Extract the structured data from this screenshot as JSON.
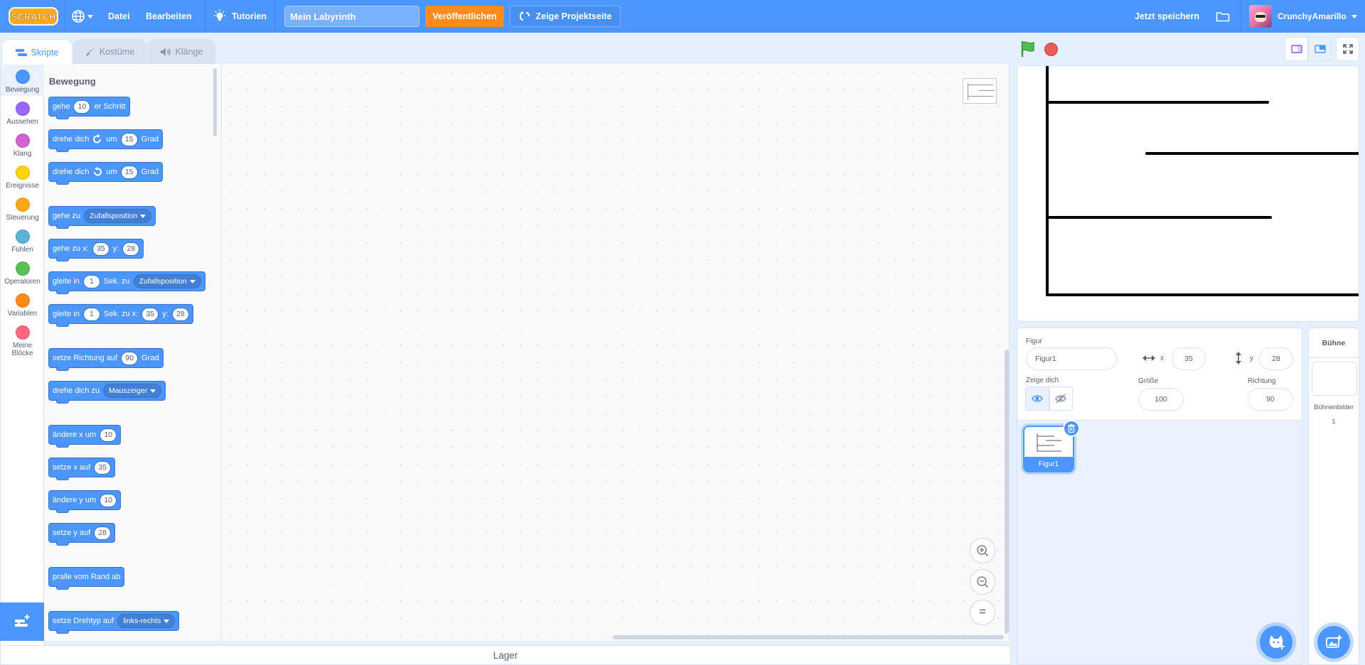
{
  "menubar": {
    "logo_text": "SCRATCH",
    "file": "Datei",
    "edit": "Bearbeiten",
    "tutorials": "Tutorien",
    "project_title": "Mein Labyrinth",
    "publish": "Veröffentlichen",
    "project_page": "Zeige Projektseite",
    "save_now": "Jetzt speichern",
    "username": "CrunchyAmarillo"
  },
  "tabs": {
    "code": "Skripte",
    "costumes": "Kostüme",
    "sounds": "Klänge"
  },
  "categories": [
    {
      "label": "Bewegung",
      "color": "#4c97ff"
    },
    {
      "label": "Aussehen",
      "color": "#9966ff"
    },
    {
      "label": "Klang",
      "color": "#cf63cf"
    },
    {
      "label": "Ereignisse",
      "color": "#ffd500"
    },
    {
      "label": "Steuerung",
      "color": "#ffab19"
    },
    {
      "label": "Fühlen",
      "color": "#5cb1d6"
    },
    {
      "label": "Operatoren",
      "color": "#59c059"
    },
    {
      "label": "Variablen",
      "color": "#ff8c1a"
    },
    {
      "label": "Meine Blöcke",
      "color": "#ff6680"
    }
  ],
  "palette": {
    "section": "Bewegung",
    "b1": {
      "a": "gehe",
      "v": "10",
      "b": "er Schritt"
    },
    "b2": {
      "a": "drehe dich",
      "b": "um",
      "v": "15",
      "c": "Grad"
    },
    "b3": {
      "a": "drehe dich",
      "b": "um",
      "v": "15",
      "c": "Grad"
    },
    "b4": {
      "a": "gehe zu",
      "dd": "Zufallsposition"
    },
    "b5": {
      "a": "gehe zu x:",
      "x": "35",
      "b": "y:",
      "y": "28"
    },
    "b6": {
      "a": "gleite in",
      "v": "1",
      "b": "Sek. zu",
      "dd": "Zufallsposition"
    },
    "b7": {
      "a": "gleite in",
      "v": "1",
      "b": "Sek. zu x:",
      "x": "35",
      "c": "y:",
      "y": "28"
    },
    "b8": {
      "a": "setze Richtung auf",
      "v": "90",
      "b": "Grad"
    },
    "b9": {
      "a": "drehe dich zu",
      "dd": "Mauszeiger"
    },
    "b10": {
      "a": "ändere x um",
      "v": "10"
    },
    "b11": {
      "a": "setze x auf",
      "v": "35"
    },
    "b12": {
      "a": "ändere y um",
      "v": "10"
    },
    "b13": {
      "a": "setze y auf",
      "v": "28"
    },
    "b14": {
      "a": "pralle vom Rand ab"
    },
    "b15": {
      "a": "setze Drehtyp auf",
      "dd": "links-rechts"
    }
  },
  "workspace": {
    "zoom_in": "+",
    "zoom_out": "−",
    "zoom_reset": "="
  },
  "backpack": "Lager",
  "sprite_info": {
    "sprite_label": "Figur",
    "sprite_name": "Figur1",
    "x_label": "x",
    "x": "35",
    "y_label": "y",
    "y": "28",
    "show_label": "Zeige dich",
    "size_label": "Größe",
    "size": "100",
    "direction_label": "Richtung",
    "direction": "90"
  },
  "sprites": [
    {
      "name": "Figur1"
    }
  ],
  "stage_pane": {
    "title": "Bühne",
    "backdrops_label": "Bühnenbilder",
    "backdrops_count": "1"
  },
  "colors": {
    "brand": "#4c97ff",
    "publish": "#ff8c1a",
    "stop": "#ec5959",
    "flag": "#4cbf56"
  }
}
